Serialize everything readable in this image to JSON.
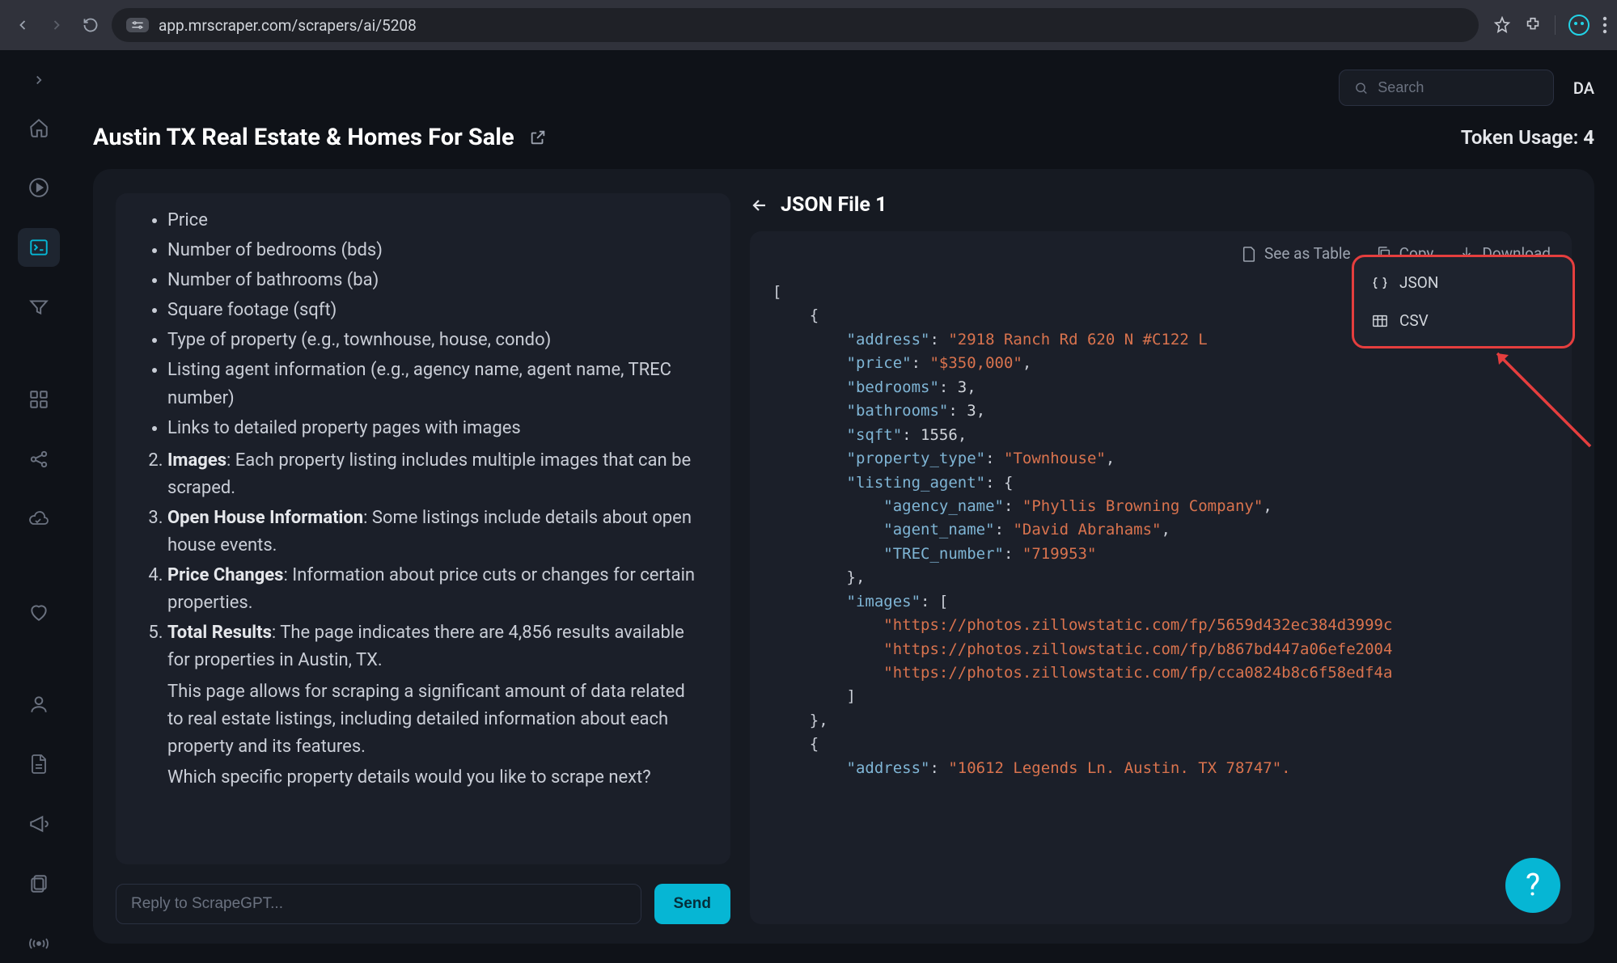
{
  "browser": {
    "url": "app.mrscraper.com/scrapers/ai/5208"
  },
  "topbar": {
    "search_placeholder": "Search",
    "user_initials": "DA"
  },
  "header": {
    "title": "Austin TX Real Estate & Homes For Sale",
    "token_label": "Token Usage: ",
    "token_count": "4"
  },
  "chat": {
    "bullet_items": [
      "Price",
      "Number of bedrooms (bds)",
      "Number of bathrooms (ba)",
      "Square footage (sqft)",
      "Type of property (e.g., townhouse, house, condo)",
      "Listing agent information (e.g., agency name, agent name, TREC number)",
      "Links to detailed property pages with images"
    ],
    "ol_items": [
      {
        "strong": "Images",
        "rest": ": Each property listing includes multiple images that can be scraped."
      },
      {
        "strong": "Open House Information",
        "rest": ": Some listings include details about open house events."
      },
      {
        "strong": "Price Changes",
        "rest": ": Information about price cuts or changes for certain properties."
      },
      {
        "strong": "Total Results",
        "rest": ": The page indicates there are 4,856 results available for properties in Austin, TX."
      }
    ],
    "para1": "This page allows for scraping a significant amount of data related to real estate listings, including detailed information about each property and its features.",
    "para2": "Which specific property details would you like to scrape next?",
    "input_placeholder": "Reply to ScrapeGPT...",
    "send_label": "Send"
  },
  "json_panel": {
    "title": "JSON File 1",
    "toolbar": {
      "see_table": "See as Table",
      "copy": "Copy",
      "download": "Download"
    },
    "dropdown": {
      "json": "JSON",
      "csv": "CSV"
    },
    "code": {
      "l1_k": "\"address\"",
      "l1_v": "\"2918 Ranch Rd 620 N #C122 L",
      "l2_k": "\"price\"",
      "l2_v": "\"$350,000\"",
      "l3_k": "\"bedrooms\"",
      "l3_v": "3",
      "l4_k": "\"bathrooms\"",
      "l4_v": "3",
      "l5_k": "\"sqft\"",
      "l5_v": "1556",
      "l6_k": "\"property_type\"",
      "l6_v": "\"Townhouse\"",
      "l7_k": "\"listing_agent\"",
      "l8_k": "\"agency_name\"",
      "l8_v": "\"Phyllis Browning Company\"",
      "l9_k": "\"agent_name\"",
      "l9_v": "\"David Abrahams\"",
      "l10_k": "\"TREC_number\"",
      "l10_v": "\"719953\"",
      "l11_k": "\"images\"",
      "l12_v": "\"https://photos.zillowstatic.com/fp/5659d432ec384d3999c",
      "l13_v": "\"https://photos.zillowstatic.com/fp/b867bd447a06efe2004",
      "l14_v": "\"https://photos.zillowstatic.com/fp/cca0824b8c6f58edf4a",
      "l15_k": "\"address\"",
      "l15_v": "\"10612 Legends Ln. Austin. TX 78747\"."
    }
  },
  "help_label": "?"
}
